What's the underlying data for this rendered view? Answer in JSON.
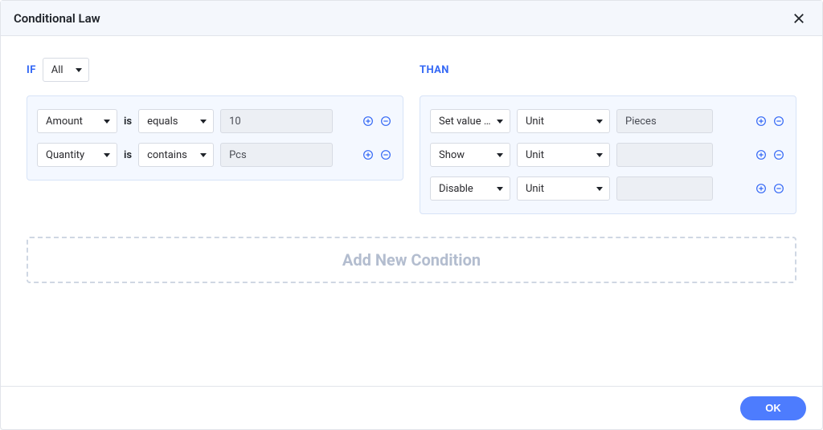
{
  "modal": {
    "title": "Conditional Law",
    "ok_label": "OK"
  },
  "if_section": {
    "keyword": "IF",
    "quantifier": "All",
    "connector": "is",
    "rows": [
      {
        "field": "Amount",
        "operator": "equals",
        "value": "10"
      },
      {
        "field": "Quantity",
        "operator": "contains",
        "value": "Pcs"
      }
    ]
  },
  "than_section": {
    "keyword": "THAN",
    "rows": [
      {
        "action": "Set value ...",
        "target": "Unit",
        "arg": "Pieces"
      },
      {
        "action": "Show",
        "target": "Unit",
        "arg": ""
      },
      {
        "action": "Disable",
        "target": "Unit",
        "arg": ""
      }
    ]
  },
  "add_new_label": "Add New Condition"
}
